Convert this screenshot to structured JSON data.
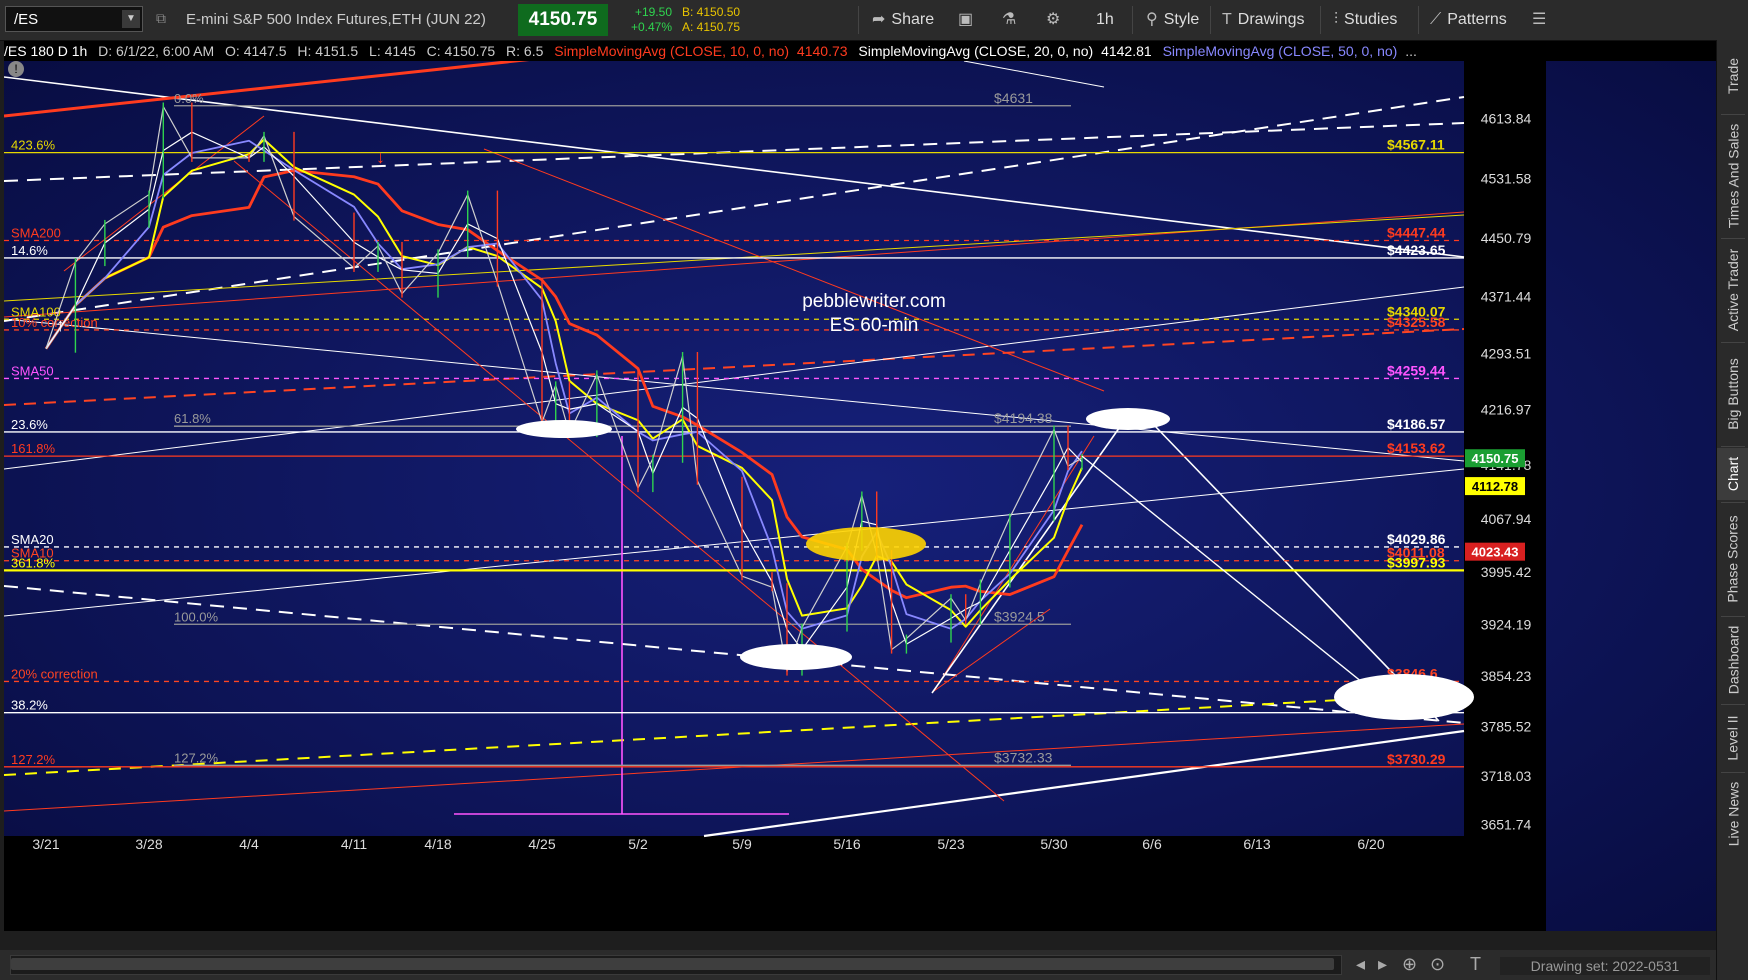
{
  "header": {
    "symbol": "/ES",
    "description": "E-mini S&P 500 Index Futures,ETH (JUN 22)",
    "last_price": "4150.75",
    "change": "+19.50",
    "change_pct": "+0.47%",
    "bid": "B: 4150.50",
    "ask": "A: 4150.75",
    "share_label": "Share",
    "interval_label": "1h",
    "style_label": "Style",
    "drawings_label": "Drawings",
    "studies_label": "Studies",
    "patterns_label": "Patterns"
  },
  "infobar": {
    "prefix": "/ES 180 D 1h",
    "date": "D: 6/1/22, 6:00 AM",
    "open": "O: 4147.5",
    "high": "H: 4151.5",
    "low": "L: 4145",
    "close": "C: 4150.75",
    "range": "R: 6.5",
    "sma10": "SimpleMovingAvg (CLOSE, 10, 0, no)",
    "sma10_val": "4140.73",
    "sma20": "SimpleMovingAvg (CLOSE, 20, 0, no)",
    "sma20_val": "4142.81",
    "sma50": "SimpleMovingAvg (CLOSE, 50, 0, no)",
    "more": "..."
  },
  "sidebar": {
    "tabs": [
      "Trade",
      "Times And Sales",
      "Active Trader",
      "Big Buttons",
      "Chart",
      "Phase Scores",
      "Dashboard",
      "Level II",
      "Live News"
    ],
    "active": "Chart"
  },
  "footer": {
    "drawing_set": "Drawing set: 2022-0531"
  },
  "chart_data": {
    "type": "candlestick",
    "interval": "1h",
    "watermark": [
      "pebblewriter.com",
      "ES 60-min"
    ],
    "x_ticks": [
      "3/21",
      "3/28",
      "4/4",
      "4/11",
      "4/18",
      "4/25",
      "5/2",
      "5/9",
      "5/16",
      "5/23",
      "5/30",
      "6/6",
      "6/13",
      "6/20"
    ],
    "y_ticks": [
      4613.84,
      4531.58,
      4450.79,
      4371.44,
      4293.51,
      4216.97,
      4141.78,
      4067.94,
      3995.42,
      3924.19,
      3854.23,
      3785.52,
      3718.03,
      3651.74
    ],
    "ylim": [
      3636,
      4692
    ],
    "price_markers": [
      {
        "label": "4150.75",
        "value": 4150.75,
        "color": "#1a9e32"
      },
      {
        "label": "4112.78",
        "value": 4112.78,
        "color": "#ffff00"
      },
      {
        "label": "4023.43",
        "value": 4023.43,
        "color": "#d82020"
      }
    ],
    "horizontal_levels": [
      {
        "left": "0.0%",
        "right": "$4631",
        "value": 4631,
        "color": "#9a9a9a",
        "dash": false
      },
      {
        "left": "423.6%",
        "right": "$4567.11",
        "value": 4567.11,
        "color": "#e6d800",
        "dash": false
      },
      {
        "left": "SMA200",
        "right": "$4447.44",
        "value": 4447.44,
        "color": "#ff3b1f",
        "dash": true
      },
      {
        "left": "14.6%",
        "right": "$4423.65",
        "value": 4423.65,
        "color": "#ffffff",
        "dash": false
      },
      {
        "left": "SMA100",
        "right": "$4340.07",
        "value": 4340.07,
        "color": "#e6d800",
        "dash": true
      },
      {
        "left": "10% correction",
        "right": "$4325.58",
        "value": 4325.58,
        "color": "#ff4422",
        "dash": true
      },
      {
        "left": "SMA50",
        "right": "$4259.44",
        "value": 4259.44,
        "color": "#ff55ff",
        "dash": true
      },
      {
        "left": "61.8%",
        "right": "$4194.38",
        "value": 4194.38,
        "color": "#9a9a9a",
        "dash": false
      },
      {
        "left": "23.6%",
        "right": "$4186.57",
        "value": 4186.57,
        "color": "#ffffff",
        "dash": false
      },
      {
        "left": "161.8%",
        "right": "$4153.62",
        "value": 4153.62,
        "color": "#ff3b1f",
        "dash": false
      },
      {
        "left": "SMA20",
        "right": "$4029.86",
        "value": 4029.86,
        "color": "#ffffff",
        "dash": true
      },
      {
        "left": "SMA10",
        "right": "$4011.08",
        "value": 4011.08,
        "color": "#ff4422",
        "dash": true
      },
      {
        "left": "361.8%",
        "right": "$3997.93",
        "value": 3997.93,
        "color": "#ffff00",
        "dash": false
      },
      {
        "left": "100.0%",
        "right": "$3924.5",
        "value": 3924.5,
        "color": "#9a9a9a",
        "dash": false
      },
      {
        "left": "20% correction",
        "right": "$3846.6",
        "value": 3846.6,
        "color": "#ff4422",
        "dash": true
      },
      {
        "left": "38.2%",
        "right": "",
        "value": 3804,
        "color": "#ffffff",
        "dash": false
      },
      {
        "left": "127.2%",
        "right": "$3730.29",
        "value": 3730.29,
        "color": "#ff3b1f",
        "dash": false
      },
      {
        "left": "127.2%",
        "right": "$3732.33",
        "value": 3732.33,
        "color": "#9a9a9a",
        "dash": false
      }
    ],
    "price_path": [
      [
        "3/21",
        4300
      ],
      [
        "3/23",
        4418
      ],
      [
        "3/25",
        4470
      ],
      [
        "3/28",
        4510
      ],
      [
        "3/29",
        4630
      ],
      [
        "3/31",
        4560
      ],
      [
        "4/4",
        4560
      ],
      [
        "4/5",
        4590
      ],
      [
        "4/7",
        4480
      ],
      [
        "4/11",
        4410
      ],
      [
        "4/13",
        4440
      ],
      [
        "4/15",
        4375
      ],
      [
        "4/18",
        4430
      ],
      [
        "4/20",
        4510
      ],
      [
        "4/22",
        4390
      ],
      [
        "4/25",
        4200
      ],
      [
        "4/26",
        4250
      ],
      [
        "4/27",
        4185
      ],
      [
        "4/29",
        4265
      ],
      [
        "5/2",
        4110
      ],
      [
        "5/3",
        4150
      ],
      [
        "5/5",
        4290
      ],
      [
        "5/6",
        4120
      ],
      [
        "5/9",
        3990
      ],
      [
        "5/11",
        3975
      ],
      [
        "5/12",
        3860
      ],
      [
        "5/13",
        3920
      ],
      [
        "5/16",
        4030
      ],
      [
        "5/17",
        4100
      ],
      [
        "5/18",
        4020
      ],
      [
        "5/19",
        3890
      ],
      [
        "5/20",
        3905
      ],
      [
        "5/23",
        3960
      ],
      [
        "5/24",
        3930
      ],
      [
        "5/25",
        3980
      ],
      [
        "5/27",
        4070
      ],
      [
        "5/30",
        4190
      ],
      [
        "5/31",
        4140
      ],
      [
        "6/1",
        4151
      ]
    ],
    "moving_averages": [
      {
        "name": "SMA10",
        "color": "#ffffff"
      },
      {
        "name": "SMA20",
        "color": "#8888ff"
      },
      {
        "name": "SMA50",
        "color": "#ffff00"
      },
      {
        "name": "SMA200",
        "color": "#ff3b1f"
      }
    ],
    "projection": [
      [
        "6/1",
        4153.6
      ],
      [
        "6/22",
        3800
      ]
    ],
    "grid": false
  }
}
